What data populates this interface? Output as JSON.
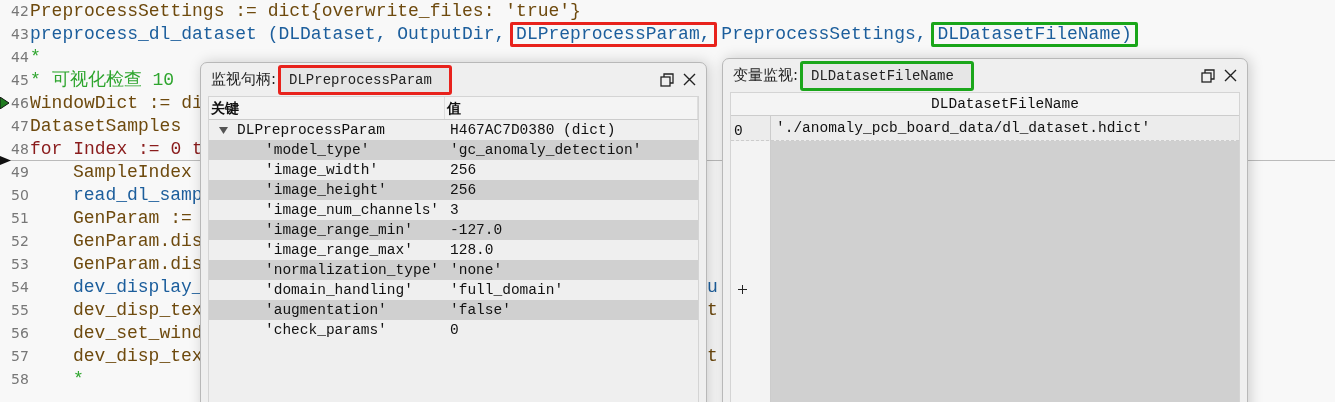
{
  "editor": {
    "lines": [
      {
        "number": "42",
        "segments": [
          {
            "text": "PreprocessSettings := dict{overwrite_files: 'true'}",
            "kind": "code"
          }
        ]
      },
      {
        "number": "43",
        "segments": [
          {
            "text": "preprocess_dl_dataset (DLDataset, OutputDir, ",
            "kind": "call"
          },
          {
            "text": "DLPreprocessParam,",
            "kind": "call",
            "color": "#e8221c"
          },
          {
            "text": " PreprocessSettings, ",
            "kind": "call"
          },
          {
            "text": "DLDatasetFileName)",
            "kind": "call",
            "color": "#1aa61a"
          }
        ]
      },
      {
        "number": "44",
        "segments": [
          {
            "text": "*",
            "kind": "comment"
          }
        ]
      },
      {
        "number": "45",
        "segments": [
          {
            "text": "* 可视化检查 10",
            "kind": "comment"
          }
        ]
      },
      {
        "number": "46",
        "pc_marker": true,
        "segments": [
          {
            "text": "WindowDict := di",
            "kind": "code"
          }
        ]
      },
      {
        "number": "47",
        "segments": [
          {
            "text": "DatasetSamples",
            "kind": "code"
          }
        ]
      },
      {
        "number": "48",
        "cursor_marker": true,
        "segments": [
          {
            "text": "for",
            "kind": "keyword"
          },
          {
            "text": " Index := 0 t",
            "kind": "keyword"
          }
        ],
        "children": [
          {
            "number": "49",
            "segments": [
              {
                "text": "SampleIndex",
                "kind": "code"
              }
            ]
          },
          {
            "number": "50",
            "segments": [
              {
                "text": "read_dl_samp",
                "kind": "call"
              }
            ]
          },
          {
            "number": "51",
            "segments": [
              {
                "text": "GenParam :=",
                "kind": "code"
              }
            ]
          },
          {
            "number": "52",
            "segments": [
              {
                "text": "GenParam.dis",
                "kind": "code"
              }
            ]
          },
          {
            "number": "53",
            "segments": [
              {
                "text": "GenParam.dis",
                "kind": "code"
              }
            ]
          },
          {
            "number": "54",
            "segments": [
              {
                "text": "dev_display_",
                "kind": "call"
              }
            ],
            "tail": {
              "text": "u",
              "kind": "call"
            }
          },
          {
            "number": "55",
            "segments": [
              {
                "text": "dev_disp_tex",
                "kind": "code"
              }
            ],
            "tail": {
              "text": "t",
              "kind": "code"
            }
          },
          {
            "number": "56",
            "segments": [
              {
                "text": "dev_set_wind",
                "kind": "code"
              }
            ]
          },
          {
            "number": "57",
            "segments": [
              {
                "text": "dev_disp_tex",
                "kind": "code"
              }
            ],
            "tail": {
              "text": "t",
              "kind": "code"
            }
          },
          {
            "number": "58",
            "segments": [
              {
                "text": "*",
                "kind": "comment"
              }
            ]
          }
        ]
      }
    ]
  },
  "watch_windows": [
    {
      "kind": "dict",
      "title": "监视句柄:",
      "variable": "DLPreprocessParam",
      "color": "#e8221c",
      "columns": [
        "关键",
        "值"
      ],
      "rows": [
        {
          "key": "DLPreprocessParam",
          "value": "H467AC7D0380 (dict)",
          "expanded": true,
          "children": [
            {
              "key": "'model_type'",
              "value": "'gc_anomaly_detection'"
            },
            {
              "key": "'image_width'",
              "value": "256"
            },
            {
              "key": "'image_height'",
              "value": "256"
            },
            {
              "key": "'image_num_channels'",
              "value": "3"
            },
            {
              "key": "'image_range_min'",
              "value": "-127.0"
            },
            {
              "key": "'image_range_max'",
              "value": "128.0"
            },
            {
              "key": "'normalization_type'",
              "value": "'none'"
            },
            {
              "key": "'domain_handling'",
              "value": "'full_domain'"
            },
            {
              "key": "'augmentation'",
              "value": "'false'"
            },
            {
              "key": "'check_params'",
              "value": "0"
            }
          ]
        }
      ]
    },
    {
      "kind": "tuple",
      "title": "变量监视:",
      "variable": "DLDatasetFileName",
      "color": "#1aa61a",
      "columns": [
        "DLDatasetFileName"
      ],
      "rows": [
        {
          "index": "0",
          "value": "'./anomaly_pcb_board_data/dl_dataset.hdict'"
        }
      ]
    }
  ]
}
